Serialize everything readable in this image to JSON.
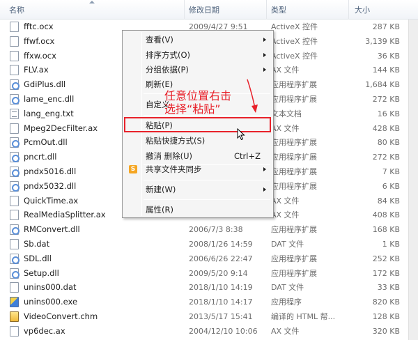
{
  "columns": {
    "name": "名称",
    "date": "修改日期",
    "type": "类型",
    "size": "大小"
  },
  "files": [
    {
      "name": "fftc.ocx",
      "date": "2009/4/27 9:51",
      "type": "ActiveX 控件",
      "size": "287 KB",
      "icon": "file-icon"
    },
    {
      "name": "ffwf.ocx",
      "date": "",
      "type": "ActiveX 控件",
      "size": "3,139 KB",
      "icon": "file-icon"
    },
    {
      "name": "ffxw.ocx",
      "date": "",
      "type": "ActiveX 控件",
      "size": "36 KB",
      "icon": "file-icon"
    },
    {
      "name": "FLV.ax",
      "date": "",
      "type": "AX 文件",
      "size": "144 KB",
      "icon": "file-icon"
    },
    {
      "name": "GdiPlus.dll",
      "date": "",
      "type": "应用程序扩展",
      "size": "1,684 KB",
      "icon": "dll-icon"
    },
    {
      "name": "lame_enc.dll",
      "date": "",
      "type": "应用程序扩展",
      "size": "272 KB",
      "icon": "dll-icon"
    },
    {
      "name": "lang_eng.txt",
      "date": "",
      "type": "文本文档",
      "size": "16 KB",
      "icon": "text-file-icon"
    },
    {
      "name": "Mpeg2DecFilter.ax",
      "date": "",
      "type": "AX 文件",
      "size": "428 KB",
      "icon": "file-icon"
    },
    {
      "name": "PcmOut.dll",
      "date": "",
      "type": "应用程序扩展",
      "size": "80 KB",
      "icon": "dll-icon"
    },
    {
      "name": "pncrt.dll",
      "date": "",
      "type": "应用程序扩展",
      "size": "272 KB",
      "icon": "dll-icon"
    },
    {
      "name": "pndx5016.dll",
      "date": "",
      "type": "应用程序扩展",
      "size": "7 KB",
      "icon": "dll-icon"
    },
    {
      "name": "pndx5032.dll",
      "date": "",
      "type": "应用程序扩展",
      "size": "6 KB",
      "icon": "dll-icon"
    },
    {
      "name": "QuickTime.ax",
      "date": "",
      "type": "AX 文件",
      "size": "84 KB",
      "icon": "file-icon"
    },
    {
      "name": "RealMediaSplitter.ax",
      "date": "",
      "type": "AX 文件",
      "size": "408 KB",
      "icon": "file-icon"
    },
    {
      "name": "RMConvert.dll",
      "date": "2006/7/3 8:38",
      "type": "应用程序扩展",
      "size": "168 KB",
      "icon": "dll-icon"
    },
    {
      "name": "Sb.dat",
      "date": "2008/1/26 14:59",
      "type": "DAT 文件",
      "size": "1 KB",
      "icon": "file-icon"
    },
    {
      "name": "SDL.dll",
      "date": "2006/6/26 22:47",
      "type": "应用程序扩展",
      "size": "252 KB",
      "icon": "dll-icon"
    },
    {
      "name": "Setup.dll",
      "date": "2009/5/20 9:14",
      "type": "应用程序扩展",
      "size": "172 KB",
      "icon": "dll-icon"
    },
    {
      "name": "unins000.dat",
      "date": "2018/1/10 14:19",
      "type": "DAT 文件",
      "size": "33 KB",
      "icon": "file-icon"
    },
    {
      "name": "unins000.exe",
      "date": "2018/1/10 14:17",
      "type": "应用程序",
      "size": "820 KB",
      "icon": "exe-icon"
    },
    {
      "name": "VideoConvert.chm",
      "date": "2013/5/17 15:41",
      "type": "编译的 HTML 帮...",
      "size": "128 KB",
      "icon": "help-file-icon"
    },
    {
      "name": "vp6dec.ax",
      "date": "2004/12/10 10:06",
      "type": "AX 文件",
      "size": "320 KB",
      "icon": "file-icon"
    }
  ],
  "context_menu": [
    {
      "label": "查看(V)",
      "submenu": true
    },
    {
      "label": "排序方式(O)",
      "submenu": true
    },
    {
      "label": "分组依据(P)",
      "submenu": true
    },
    {
      "label": "刷新(E)",
      "submenu": false
    },
    {
      "label": "自定义",
      "submenu": false
    },
    {
      "label": "粘贴(P)",
      "submenu": false
    },
    {
      "label": "粘贴快捷方式(S)",
      "submenu": false
    },
    {
      "label": "撤消 删除(U)",
      "submenu": false,
      "shortcut": "Ctrl+Z"
    },
    {
      "label": "共享文件夹同步",
      "submenu": true,
      "icon": "share-sync-icon"
    },
    {
      "label": "新建(W)",
      "submenu": true
    },
    {
      "label": "属性(R)",
      "submenu": false
    }
  ],
  "annotation": {
    "line1": "任意位置右击",
    "line2": "选择“粘贴”"
  },
  "colors": {
    "annotation_red": "#e8212a",
    "header_text": "#4c607a",
    "menu_background": "#f5f5f5"
  }
}
